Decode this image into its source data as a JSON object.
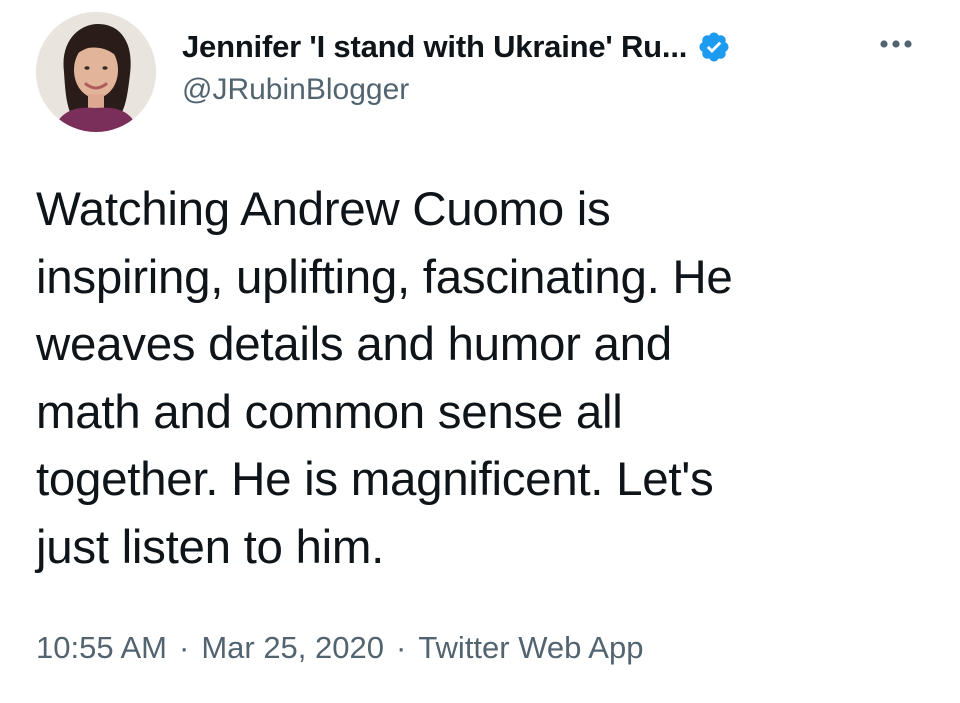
{
  "author": {
    "display_name": "Jennifer 'I stand with Ukraine' Ru...",
    "handle": "@JRubinBlogger",
    "verified": true,
    "verified_icon": "verified-badge-icon",
    "avatar_icon": "profile-photo"
  },
  "tweet": {
    "text": "Watching Andrew Cuomo is\ninspiring, uplifting, fascinating. He\nweaves details and humor and\nmath and common sense all\ntogether. He is magnificent. Let's\njust listen to him."
  },
  "meta": {
    "time": "10:55 AM",
    "separator": "·",
    "date": "Mar 25, 2020",
    "source": "Twitter Web App"
  },
  "more_icon": "more-options-icon",
  "colors": {
    "text": "#0f1419",
    "secondary": "#536471",
    "verified": "#1d9bf0"
  }
}
